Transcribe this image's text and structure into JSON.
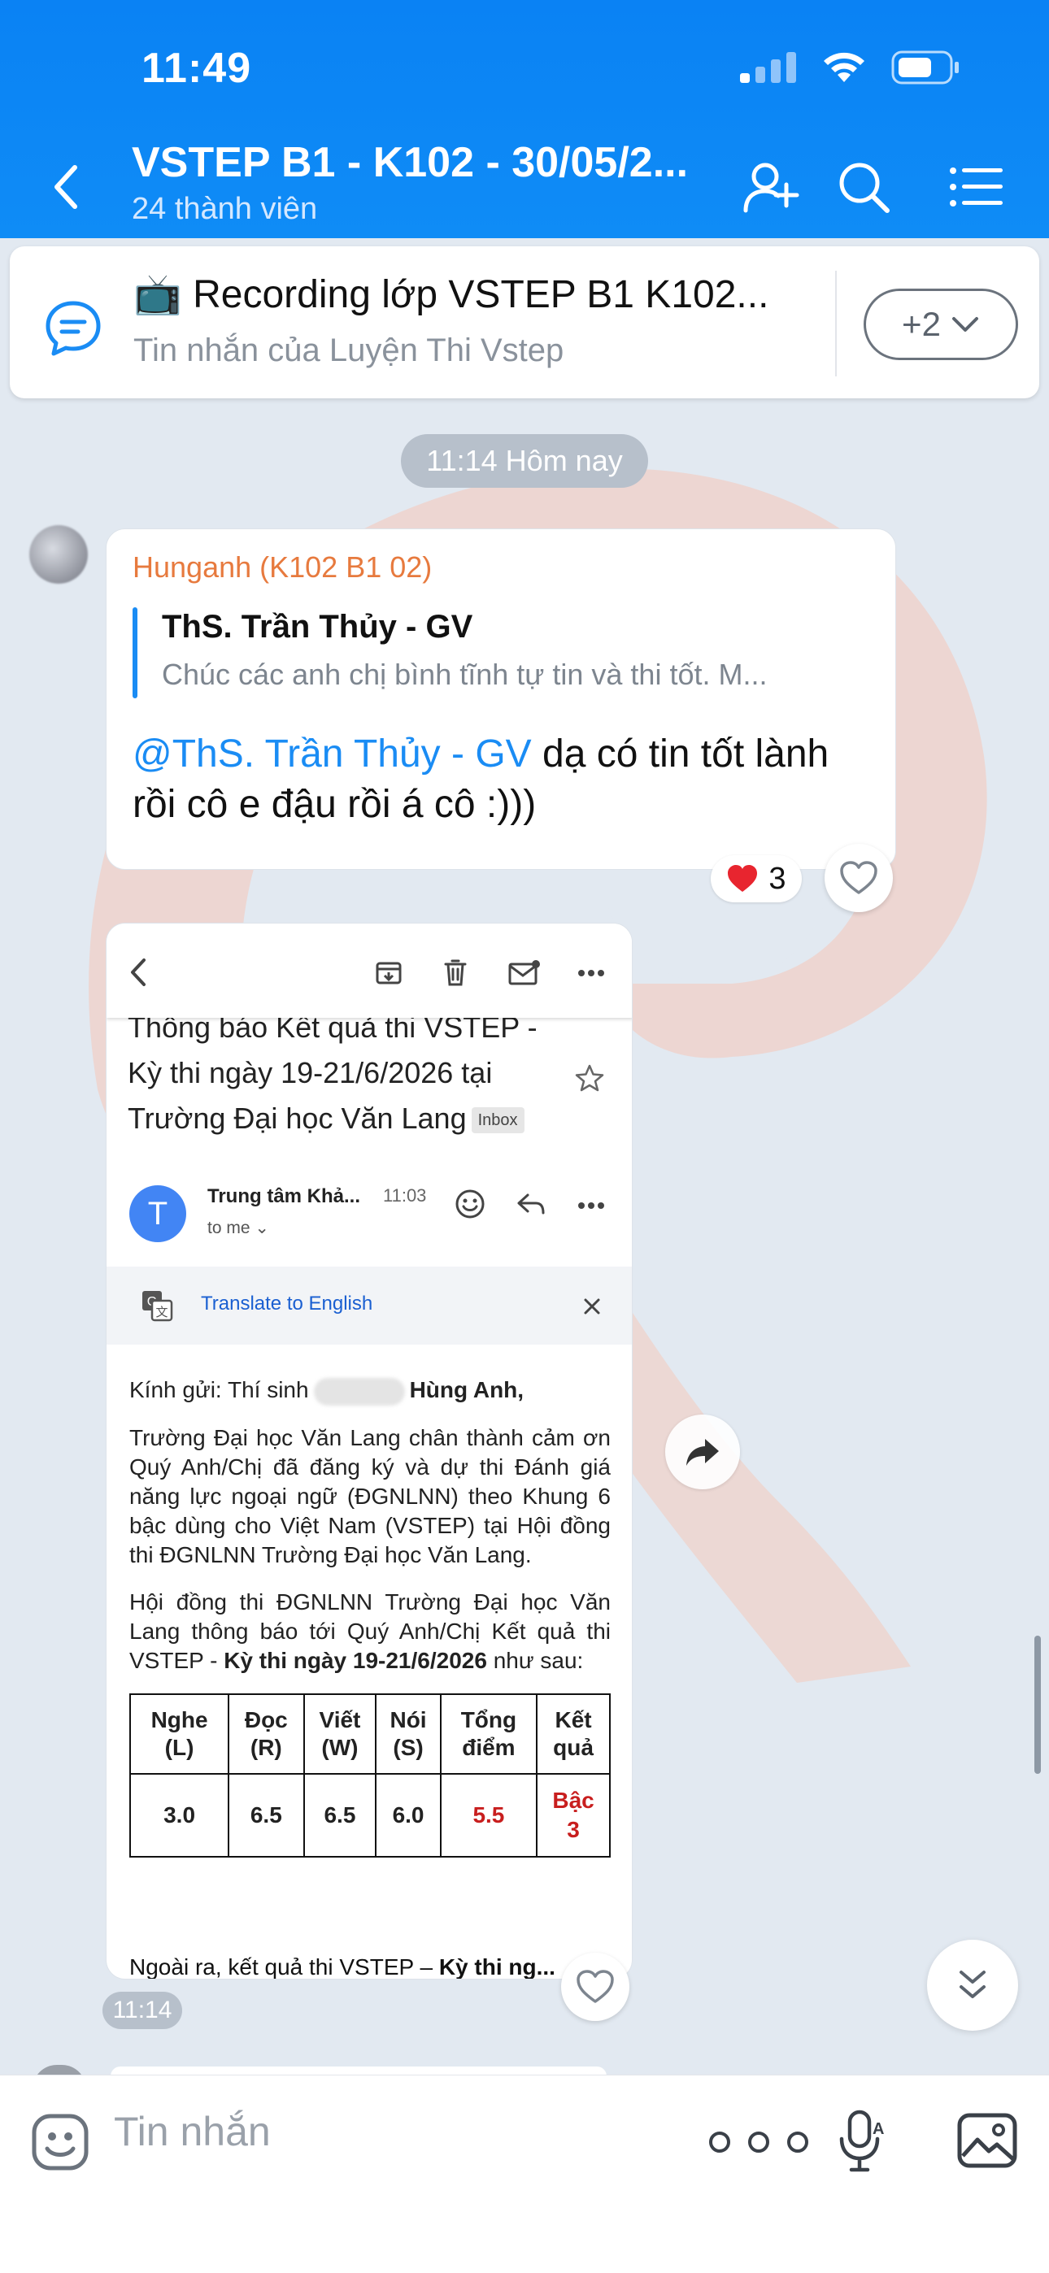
{
  "status_bar": {
    "time": "11:49"
  },
  "header": {
    "title": "VSTEP B1 - K102 - 30/05/2...",
    "subtitle": "24 thành viên"
  },
  "pinned": {
    "emoji": "📺",
    "title": "Recording lớp VSTEP B1 K102...",
    "subtitle": "Tin nhắn của Luyện Thi Vstep",
    "more_label": "+2"
  },
  "timeline": {
    "time_pill": "11:14 Hôm nay"
  },
  "message1": {
    "sender": "Hunganh (K102 B1 02)",
    "quote_name": "ThS. Trần Thủy - GV",
    "quote_text": "Chúc các anh chị bình tĩnh tự tin và thi tốt. M...",
    "mention": "@ThS. Trần Thủy - GV",
    "text": " dạ có tin tốt lành rồi cô e đậu rồi á cô :)))",
    "reaction_emoji": "❤️",
    "reaction_count": "3"
  },
  "email": {
    "subject": "Thông báo Kết quả thi VSTEP - Kỳ thi ngày 19-21/6/2026 tại Trường Đại học Văn Lang",
    "inbox_label": "Inbox",
    "sender_initial": "T",
    "sender_name": "Trung tâm Khả...",
    "time": "11:03",
    "to": "to me",
    "translate_label": "Translate to English",
    "greeting_prefix": "Kính gửi: Thí sinh",
    "greeting_name": "Hùng Anh,",
    "para1": "Trường Đại học Văn Lang chân thành cảm ơn Quý Anh/Chị đã đăng ký và dự thi Đánh giá năng lực ngoại ngữ (ĐGNLNN) theo Khung 6 bậc dùng cho Việt Nam (VSTEP) tại Hội đồng thi ĐGNLNN Trường Đại học Văn Lang.",
    "para2_prefix": "Hội đồng thi ĐGNLNN Trường Đại học Văn Lang thông báo tới Quý Anh/Chị Kết quả thi VSTEP - ",
    "para2_bold": "Kỳ thi ngày 19-21/6/2026",
    "para2_suffix": " như sau:",
    "table_headers": [
      [
        "Nghe",
        "(L)"
      ],
      [
        "Đọc",
        "(R)"
      ],
      [
        "Viết",
        "(W)"
      ],
      [
        "Nói",
        "(S)"
      ],
      [
        "Tổng",
        "điểm"
      ],
      [
        "Kết",
        "quả"
      ]
    ],
    "table_values": [
      "3.0",
      "6.5",
      "6.5",
      "6.0",
      "5.5",
      [
        "Bậc",
        "3"
      ]
    ],
    "footer_prefix": "Ngoài ra, kết quả thi VSTEP – ",
    "footer_bold": "Kỳ thi ng..."
  },
  "image_time": "11:14",
  "composer": {
    "placeholder": "Tin nhắn"
  },
  "colors": {
    "header_blue": "#0f8cf6",
    "mention_blue": "#1a8cf4",
    "sender_orange": "#e77a3e",
    "result_red": "#c81e1e"
  }
}
